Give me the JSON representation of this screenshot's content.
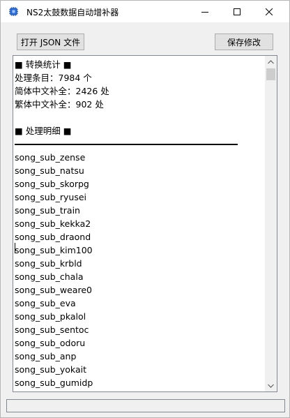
{
  "window": {
    "title": "NS2太鼓数据自动增补器"
  },
  "toolbar": {
    "open_label": "打开 JSON 文件",
    "save_label": "保存修改"
  },
  "output": {
    "stats_header": "■ 转换统计 ■",
    "stats": [
      "处理条目：7984 个",
      "简体中文补全：2426 处",
      "繁体中文补全：902 处"
    ],
    "details_header": "■ 处理明细 ■",
    "entries": [
      "song_sub_zense",
      "song_sub_natsu",
      "song_sub_skorpg",
      "song_sub_ryusei",
      "song_sub_train",
      "song_sub_kekka2",
      "song_sub_draond",
      "song_sub_kim100",
      "song_sub_krbld",
      "song_sub_chala",
      "song_sub_weare0",
      "song_sub_eva",
      "song_sub_pkalol",
      "song_sub_sentoc",
      "song_sub_odoru",
      "song_sub_anp",
      "song_sub_yokait",
      "song_sub_gumidp"
    ]
  },
  "statusbar": {
    "text": ""
  }
}
